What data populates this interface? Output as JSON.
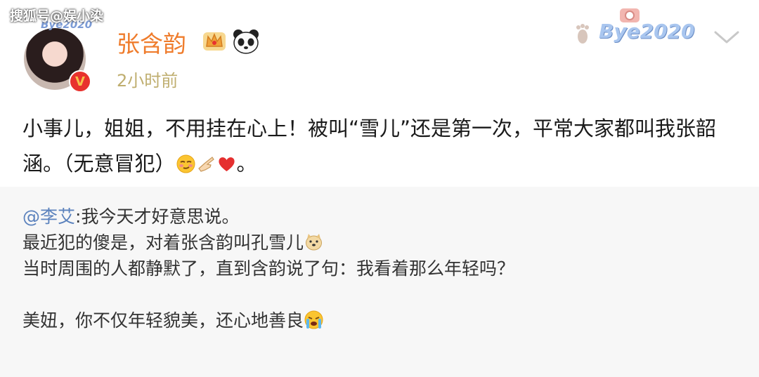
{
  "watermark": "搜狐号@娱小染",
  "post": {
    "author": "张含韵",
    "time": "2小时前",
    "avatar_pendant": "Bye2020",
    "card_decoration": "Bye2020",
    "text_before_emoji": "小事儿，姐姐，不用挂在心上！被叫“雪儿”还是第一次，平常大家都叫我张韶涵。（无意冒犯）",
    "text_after_emoji": "。",
    "emojis": [
      "smirk-face-emoji",
      "pointing-hand-emoji",
      "red-heart-emoji"
    ],
    "badges": [
      "crown-icon",
      "panda-icon"
    ]
  },
  "repost": {
    "mention": "@李艾",
    "line1_text": ":我今天才好意思说。",
    "line2_text": "最近犯的傻是，对着张含韵叫孔雪儿",
    "line3_text": "当时周围的人都静默了，直到含韵说了句：我看着那么年轻吗？",
    "line5_text": "美妞，你不仅年轻貌美，还心地善良",
    "emojis": [
      "doge-emoji",
      "crying-face-emoji"
    ]
  },
  "colors": {
    "username": "#ef7c2c",
    "time": "#bfae6f",
    "mention": "#5b82bd",
    "repost_bg": "#f7f7f7"
  }
}
